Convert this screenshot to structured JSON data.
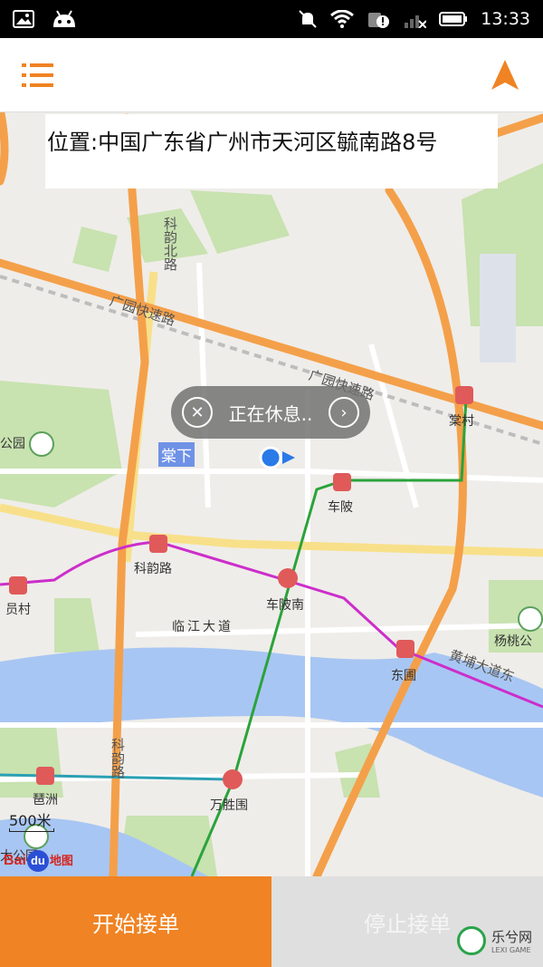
{
  "status_bar": {
    "time": "13:33"
  },
  "header": {
    "menu_icon": "menu-icon",
    "nav_icon": "navigation-arrow-icon",
    "accent_color": "#f08323"
  },
  "location": {
    "text": "位置:中国广东省广州市天河区毓南路8号"
  },
  "status_bubble": {
    "text": "正在休息..",
    "close_icon": "close-circle-icon",
    "next_icon": "chevron-right-icon"
  },
  "map": {
    "highlight_label": "棠下",
    "labels": {
      "chelpi": "车陂",
      "keyun_road": "科韵路",
      "chelpi_south": "车陂南",
      "yuancun": "员村",
      "dongpu": "东圃",
      "linjiang": "临江大道",
      "yangtao": "杨桃公",
      "pazhou": "琶洲",
      "wanshengwei": "万胜围",
      "park_left": "公园",
      "park_bottom": "大公园",
      "keyun_north": "科韵北路",
      "keyun_south": "科韵路",
      "guangyuan1": "广园快速路",
      "guangyuan2": "广园快速路",
      "huangpu": "黄埔大道东",
      "liantang": "棠村"
    },
    "scale": "500米",
    "baidu": {
      "bai": "Bai",
      "du": "du",
      "map": "地图"
    }
  },
  "actions": {
    "start": "开始接单",
    "stop": "停止接单"
  },
  "watermark": {
    "text": "乐兮网",
    "sub": "LEXI GAME"
  }
}
